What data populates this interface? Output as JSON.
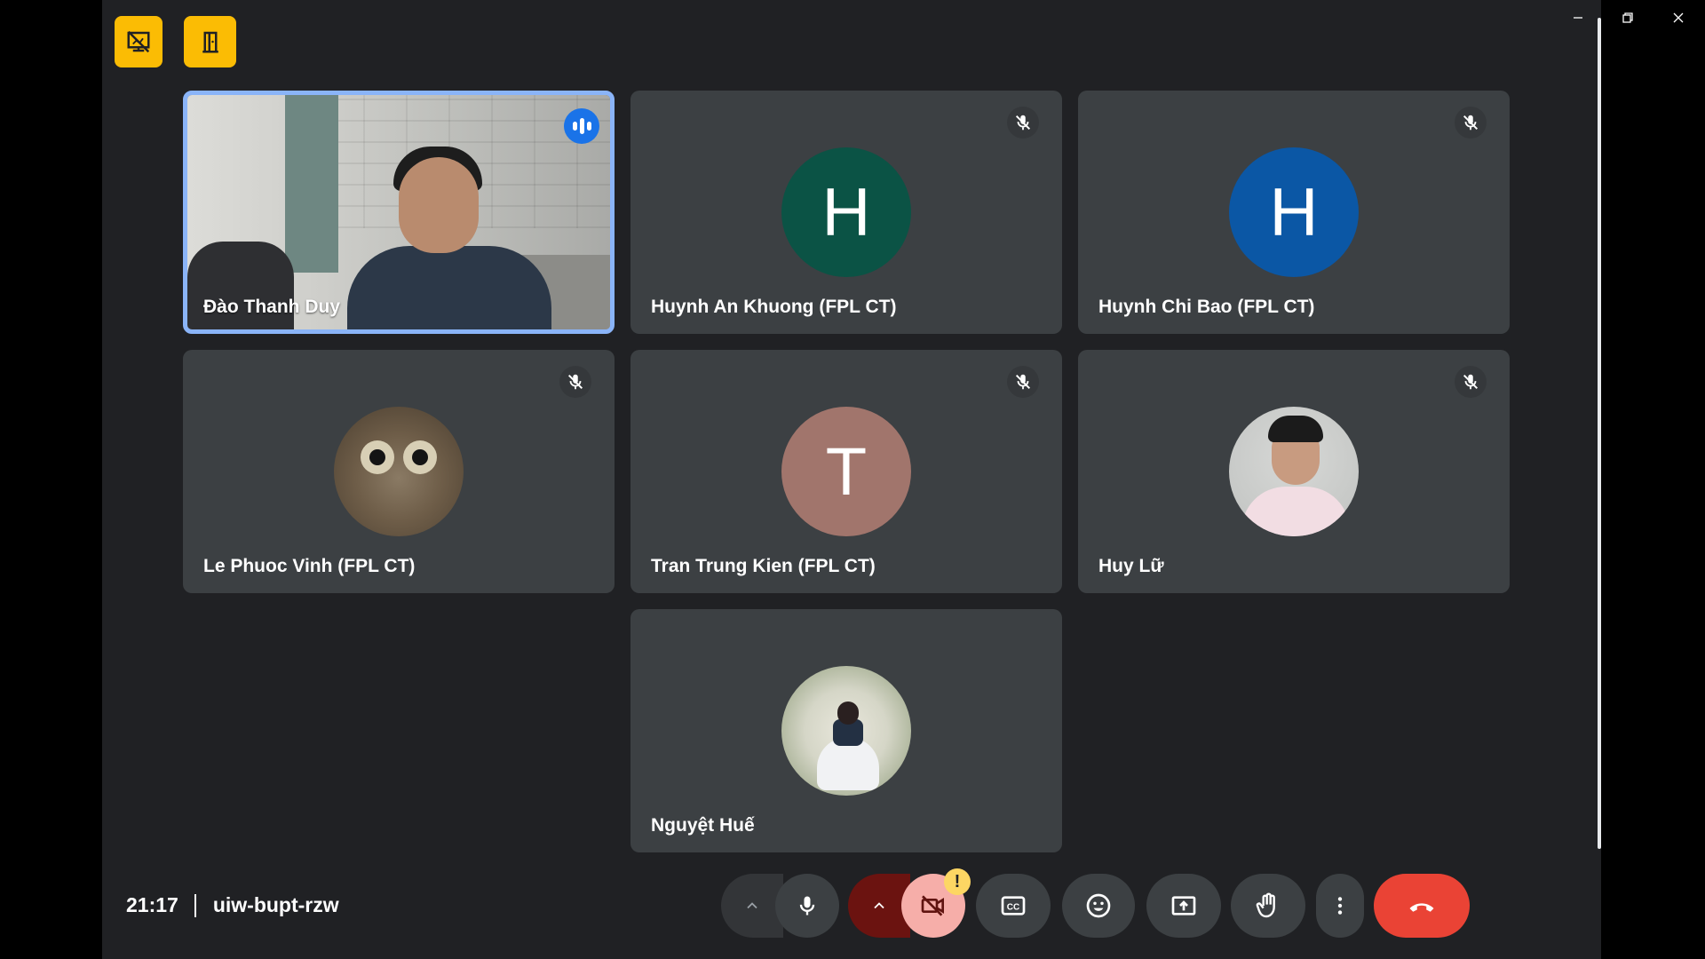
{
  "window": {
    "controls": {
      "minimize": "minimize-icon",
      "maximize": "restore-icon",
      "close": "close-icon"
    }
  },
  "top_buttons": [
    {
      "icon": "presentation-off-icon"
    },
    {
      "icon": "door-exit-icon"
    }
  ],
  "participants": [
    {
      "name": "Đào Thanh Duy",
      "status": "speaking",
      "type": "video"
    },
    {
      "name": "Huynh An Khuong (FPL CT)",
      "status": "muted",
      "type": "initial",
      "initial": "H",
      "color": "#0b5345"
    },
    {
      "name": "Huynh Chi Bao (FPL CT)",
      "status": "muted",
      "type": "initial",
      "initial": "H",
      "color": "#0b57a5"
    },
    {
      "name": "Le Phuoc Vinh (FPL CT)",
      "status": "muted",
      "type": "photo",
      "photo": "cat"
    },
    {
      "name": "Tran Trung Kien (FPL CT)",
      "status": "muted",
      "type": "initial",
      "initial": "T",
      "color": "#a1756c"
    },
    {
      "name": "Huy Lữ",
      "status": "muted",
      "type": "photo",
      "photo": "person"
    },
    {
      "name": "Nguyệt Huế",
      "status": "none",
      "type": "photo",
      "photo": "person-garden"
    }
  ],
  "meeting": {
    "time": "21:17",
    "code": "uiw-bupt-rzw"
  },
  "controls": {
    "mic": {
      "icon": "microphone-icon",
      "state": "on"
    },
    "camera": {
      "icon": "camera-off-icon",
      "state": "off",
      "warning": "!"
    },
    "captions": {
      "icon": "closed-captions-icon"
    },
    "reactions": {
      "icon": "emoji-icon"
    },
    "present": {
      "icon": "present-screen-icon"
    },
    "raise_hand": {
      "icon": "hand-icon"
    },
    "more": {
      "icon": "more-vert-icon"
    },
    "end_call": {
      "icon": "end-call-icon",
      "color": "#ea4335"
    }
  },
  "colors": {
    "background": "#202124",
    "tile": "#3c4043",
    "active_border": "#8ab4f8",
    "accent": "#fbbc04"
  }
}
